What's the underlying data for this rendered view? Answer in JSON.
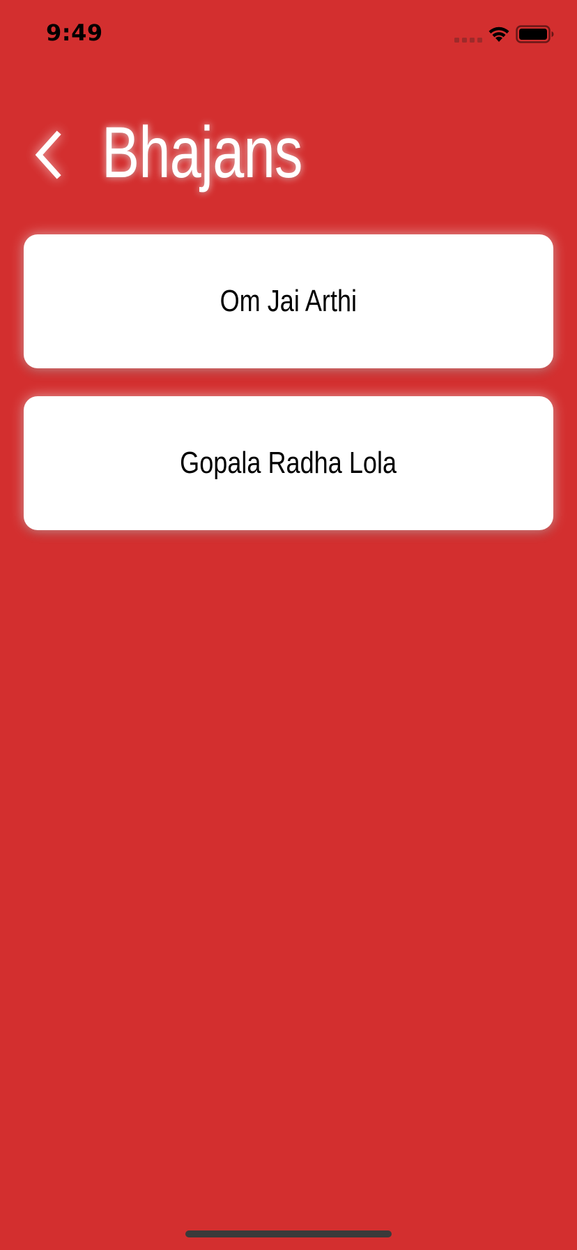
{
  "status_bar": {
    "time": "9:49"
  },
  "header": {
    "title": "Bhajans",
    "back_icon": "chevron-left-icon"
  },
  "list": {
    "items": [
      {
        "label": "Om Jai Arthi"
      },
      {
        "label": "Gopala Radha Lola"
      }
    ]
  },
  "colors": {
    "background": "#D32F2F",
    "card": "#FFFFFF",
    "title": "#FFFFFF",
    "text": "#000000"
  }
}
